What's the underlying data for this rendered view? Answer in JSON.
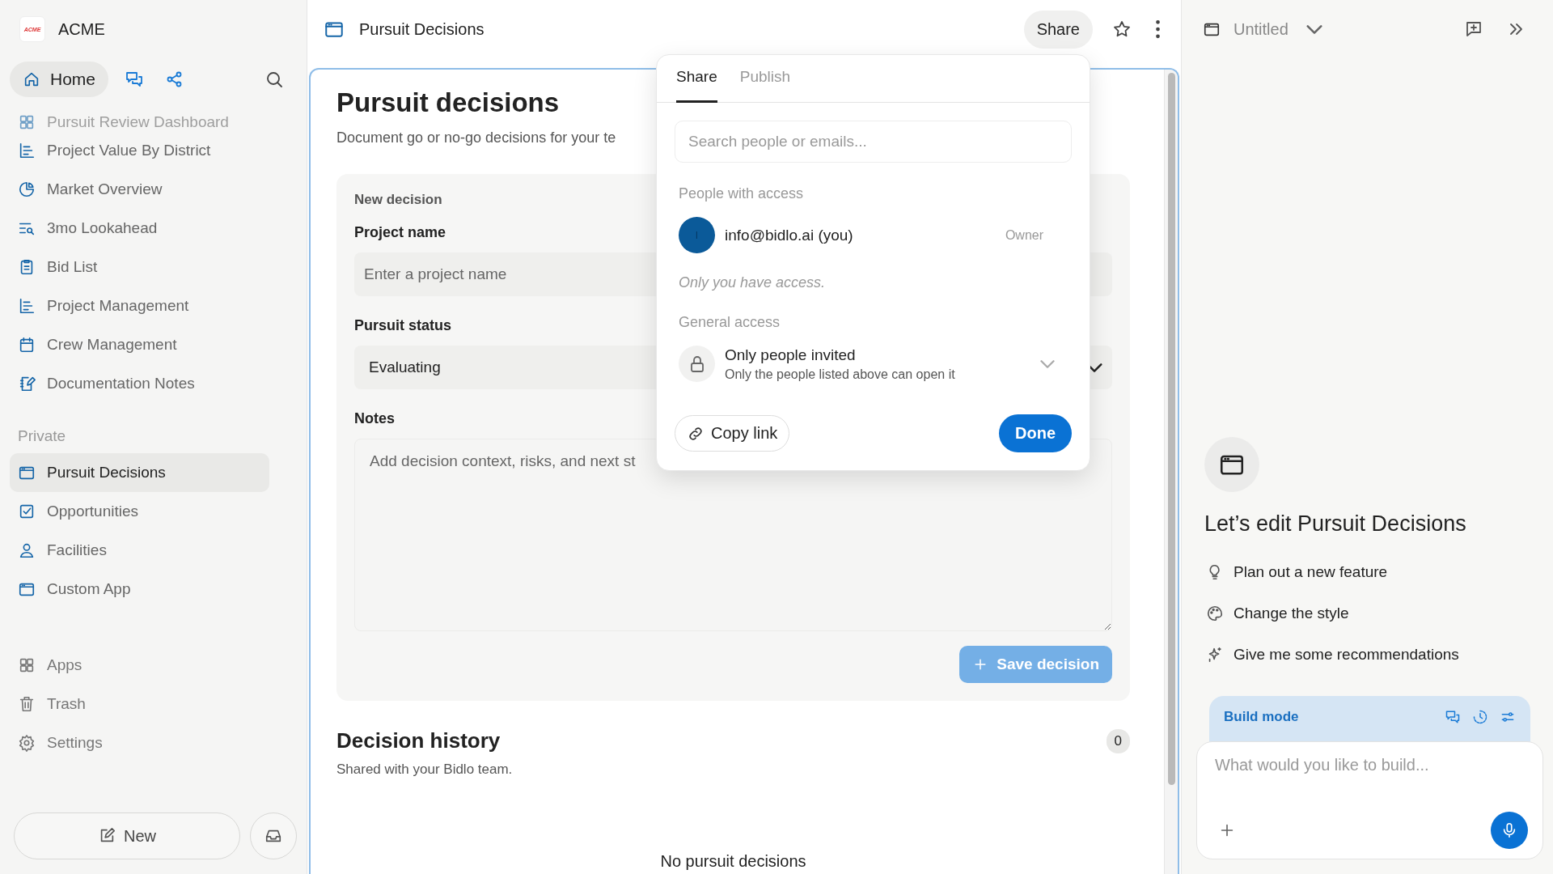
{
  "sidebar": {
    "logo_text": "ACME",
    "workspace": "ACME",
    "nav": [
      {
        "kind": "home",
        "label": "Home",
        "selected": true
      },
      {
        "kind": "chat",
        "selected": false
      },
      {
        "kind": "graph",
        "selected": false
      }
    ],
    "items": [
      {
        "label": "Pursuit Review Dashboard",
        "faded": true
      },
      {
        "label": "Project Value By District",
        "faded": false
      },
      {
        "label": "Market Overview",
        "faded": false
      },
      {
        "label": "3mo Lookahead",
        "faded": false
      },
      {
        "label": "Bid List",
        "faded": false
      },
      {
        "label": "Project Management",
        "faded": false
      },
      {
        "label": "Crew Management",
        "faded": false
      },
      {
        "label": "Documentation Notes",
        "faded": false
      }
    ],
    "private_label": "Private",
    "private_items": [
      {
        "label": "Pursuit Decisions",
        "selected": true
      },
      {
        "label": "Opportunities",
        "selected": false
      },
      {
        "label": "Facilities",
        "selected": false
      },
      {
        "label": "Custom App",
        "selected": false
      }
    ],
    "footer_items": [
      {
        "label": "Apps"
      },
      {
        "label": "Trash"
      },
      {
        "label": "Settings"
      }
    ],
    "new_button": "New"
  },
  "topbar": {
    "title": "Pursuit Decisions",
    "share_button": "Share"
  },
  "page": {
    "title": "Pursuit decisions",
    "subtitle": "Document go or no-go decisions for your te",
    "form": {
      "heading": "New decision",
      "fields": [
        {
          "kind": "text",
          "label": "Project name",
          "placeholder": "Enter a project name"
        },
        {
          "kind": "select",
          "label": "Pursuit status",
          "value": "Evaluating"
        },
        {
          "kind": "textarea",
          "label": "Notes",
          "placeholder": "Add decision context, risks, and next st"
        }
      ],
      "save_button": {
        "label": "Save decision",
        "disabled": true
      }
    },
    "history": {
      "title": "Decision history",
      "count": "0",
      "subtitle": "Shared with your Bidlo team.",
      "empty_text": "No pursuit decisions"
    }
  },
  "share_popover": {
    "tabs": [
      {
        "label": "Share",
        "selected": true
      },
      {
        "label": "Publish",
        "selected": false
      }
    ],
    "search": {
      "placeholder": "Search people or emails..."
    },
    "people_label": "People with access",
    "people": [
      {
        "initial": "I",
        "email": "info@bidlo.ai (you)",
        "role": "Owner"
      }
    ],
    "note": "Only you have access.",
    "general_label": "General access",
    "access": {
      "title": "Only people invited",
      "description": "Only the people listed above can open it"
    },
    "copy_link": "Copy link",
    "done": "Done"
  },
  "assistant": {
    "chat_title": "Untitled",
    "headline": "Let’s edit Pursuit Decisions",
    "suggestions": [
      {
        "label": "Plan out a new feature"
      },
      {
        "label": "Change the style"
      },
      {
        "label": "Give me some recommendations"
      }
    ],
    "mode": "Build mode",
    "input": {
      "placeholder": "What would you like to build..."
    }
  }
}
